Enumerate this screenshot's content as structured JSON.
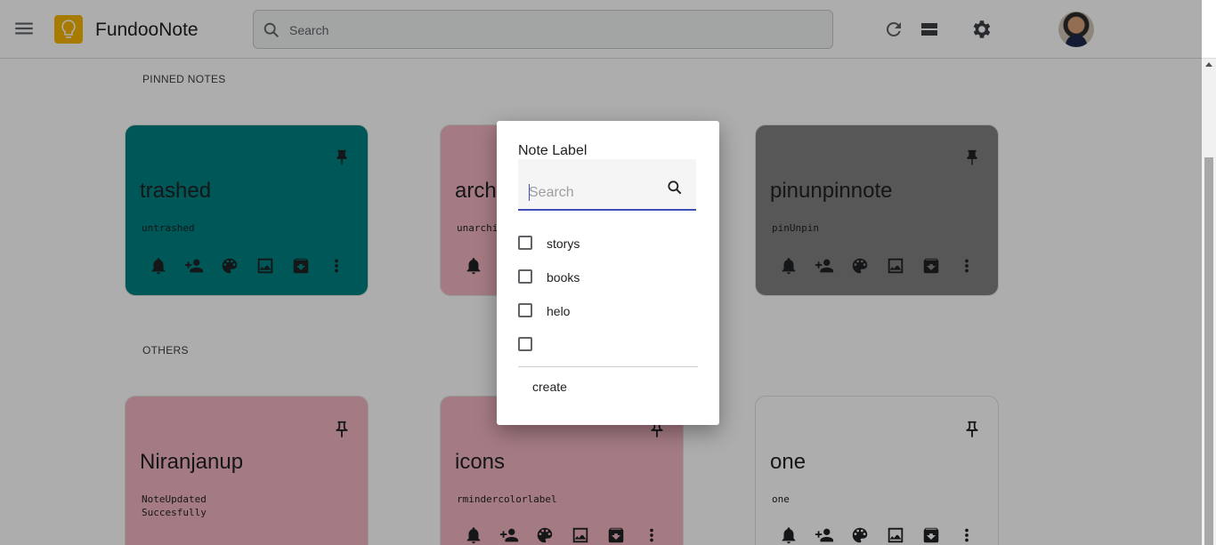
{
  "app": {
    "title": "FundooNote"
  },
  "search": {
    "placeholder": "Search"
  },
  "sections": {
    "pinned": "PINNED NOTES",
    "others": "OTHERS"
  },
  "colors": {
    "teal": "#008080",
    "pink": "#f4b6c2",
    "gray": "#808080",
    "white": "#ffffff",
    "accent": "#3f51b5"
  },
  "notes": [
    {
      "title": "trashed",
      "body": "untrashed",
      "color": "teal"
    },
    {
      "title": "archived",
      "body": "unarchived",
      "color": "pink"
    },
    {
      "title": "pinunpinnote",
      "body": "pinUnpin",
      "color": "gray"
    },
    {
      "title": "Niranjanup",
      "body": "NoteUpdated\nSuccesfully",
      "color": "pink"
    },
    {
      "title": "icons",
      "body": "rmindercolorlabel",
      "color": "pink"
    },
    {
      "title": "one",
      "body": "one",
      "color": "white"
    }
  ],
  "note_actions": [
    "bell-icon",
    "add-collaborator-icon",
    "palette-icon",
    "image-icon",
    "archive-icon",
    "more-vert-icon"
  ],
  "dialog": {
    "title": "Note Label",
    "search_placeholder": "Search",
    "labels": [
      {
        "text": "storys",
        "checked": false
      },
      {
        "text": "books",
        "checked": false
      },
      {
        "text": "helo",
        "checked": false
      },
      {
        "text": "",
        "checked": false
      }
    ],
    "create_label": "create"
  }
}
